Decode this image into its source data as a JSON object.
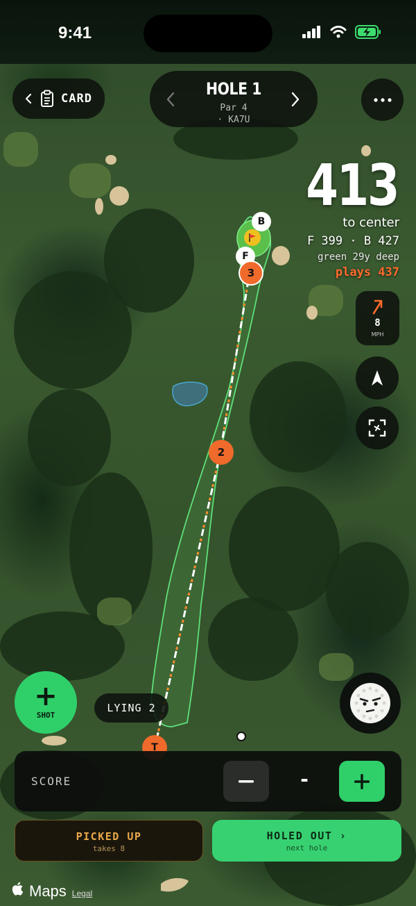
{
  "status_bar": {
    "time": "9:41"
  },
  "top_nav": {
    "card_label": "CARD",
    "hole_title": "HOLE 1",
    "hole_par": "Par 4",
    "hole_course": "· KA7U"
  },
  "distance": {
    "value": "413",
    "label": "to center",
    "front_back": "F 399 · B 427",
    "green_depth": "green 29y deep",
    "plays": "plays 437"
  },
  "wind": {
    "speed": "8",
    "unit": "MPH"
  },
  "map_markers": {
    "back": "B",
    "front": "F",
    "shot3": "3",
    "shot2": "2",
    "tee": "T"
  },
  "shot_button": {
    "label": "SHOT"
  },
  "lying": {
    "label": "LYING 2"
  },
  "score": {
    "label": "SCORE",
    "value": "-"
  },
  "picked_up": {
    "title": "PICKED UP",
    "subtitle": "takes 8"
  },
  "holed_out": {
    "title": "HOLED OUT ›",
    "subtitle": "next hole"
  },
  "attribution": {
    "maps": "Maps",
    "legal": "Legal"
  },
  "colors": {
    "accent_green": "#2fd06a",
    "plays_orange": "#ff6a2b",
    "picked_gold": "#e9a94a"
  }
}
